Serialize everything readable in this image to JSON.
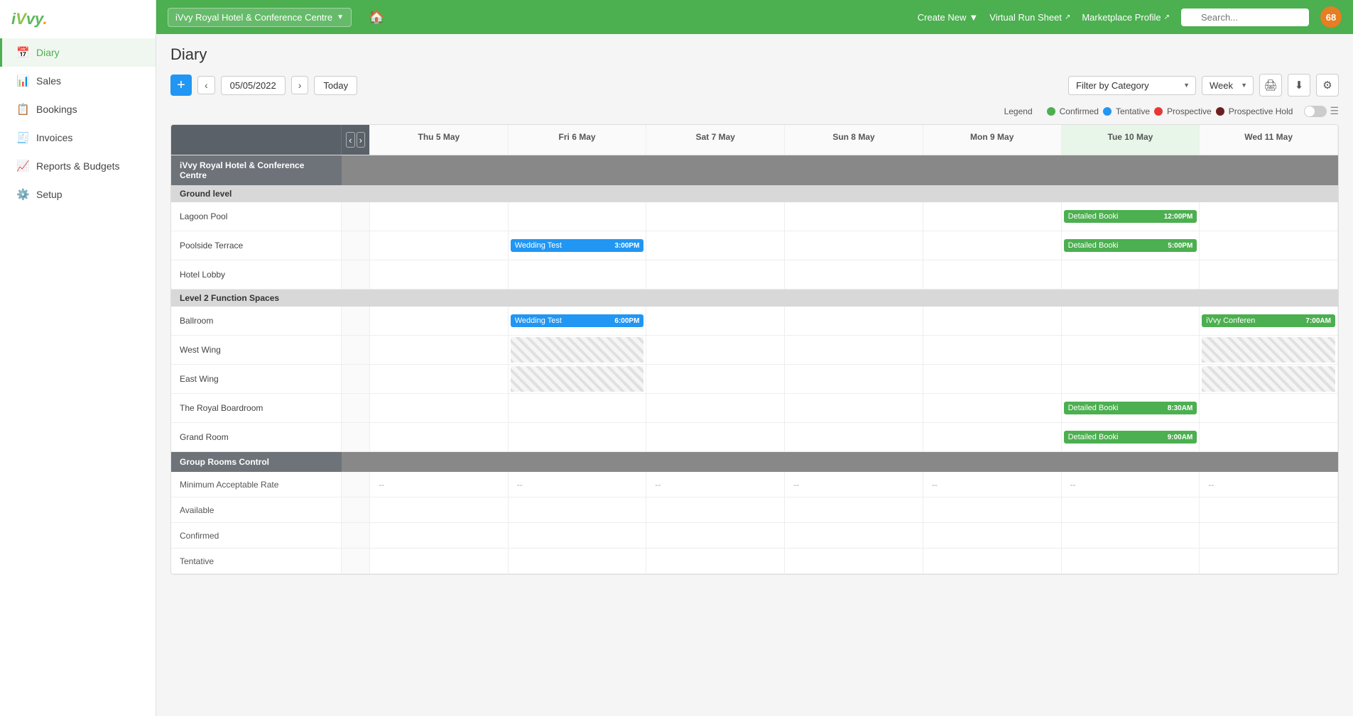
{
  "app": {
    "logo": "iVvy.",
    "badge_count": "68"
  },
  "topbar": {
    "venue": "iVvy Royal Hotel & Conference Centre",
    "home_icon": "🏠",
    "links": [
      {
        "label": "Create New",
        "ext": false,
        "dropdown": true
      },
      {
        "label": "Virtual Run Sheet",
        "ext": true
      },
      {
        "label": "Marketplace Profile",
        "ext": true
      }
    ],
    "search_placeholder": "Search..."
  },
  "sidebar": {
    "items": [
      {
        "label": "Diary",
        "icon": "📅",
        "active": true
      },
      {
        "label": "Sales",
        "icon": "📊",
        "active": false
      },
      {
        "label": "Bookings",
        "icon": "📋",
        "active": false
      },
      {
        "label": "Invoices",
        "icon": "🧾",
        "active": false
      },
      {
        "label": "Reports & Budgets",
        "icon": "📈",
        "active": false
      },
      {
        "label": "Setup",
        "icon": "⚙️",
        "active": false
      }
    ]
  },
  "diary": {
    "title": "Diary",
    "date": "05/05/2022",
    "today_label": "Today",
    "filter_placeholder": "Filter by Category",
    "view_mode": "Week",
    "legend_label": "Legend",
    "legend": [
      {
        "label": "Confirmed",
        "color": "#4caf50"
      },
      {
        "label": "Tentative",
        "color": "#2196f3"
      },
      {
        "label": "Prospective",
        "color": "#e53935"
      },
      {
        "label": "Prospective Hold",
        "color": "#8d2a2a"
      }
    ]
  },
  "calendar": {
    "days": [
      {
        "label": "Thu 5 May"
      },
      {
        "label": "Fri 6 May"
      },
      {
        "label": "Sat 7 May"
      },
      {
        "label": "Sun 8 May"
      },
      {
        "label": "Mon 9 May"
      },
      {
        "label": "Tue 10 May"
      },
      {
        "label": "Wed 11 May"
      }
    ],
    "sections": [
      {
        "label": "iVvy Royal Hotel & Conference Centre",
        "type": "venue-header"
      },
      {
        "label": "Ground level",
        "type": "subsection",
        "rooms": [
          {
            "name": "Lagoon Pool",
            "events": [
              null,
              null,
              null,
              null,
              null,
              {
                "name": "Detailed Booki",
                "time": "12:00PM",
                "type": "confirmed"
              },
              null
            ]
          },
          {
            "name": "Poolside Terrace",
            "events": [
              null,
              {
                "name": "Wedding Test",
                "time": "3:00PM",
                "type": "blue"
              },
              null,
              null,
              null,
              {
                "name": "Detailed Booki",
                "time": "5:00PM",
                "type": "confirmed"
              },
              null
            ]
          },
          {
            "name": "Hotel Lobby",
            "events": [
              null,
              null,
              null,
              null,
              null,
              null,
              null
            ]
          }
        ]
      },
      {
        "label": "Level 2 Function Spaces",
        "type": "subsection",
        "rooms": [
          {
            "name": "Ballroom",
            "events": [
              null,
              {
                "name": "Wedding Test",
                "time": "6:00PM",
                "type": "blue"
              },
              null,
              null,
              null,
              null,
              {
                "name": "iVvy Conferen",
                "time": "7:00AM",
                "type": "confirmed"
              }
            ]
          },
          {
            "name": "West Wing",
            "events": [
              null,
              "hatched",
              null,
              null,
              null,
              null,
              "hatched"
            ]
          },
          {
            "name": "East Wing",
            "events": [
              null,
              "hatched",
              null,
              null,
              null,
              null,
              "hatched"
            ]
          },
          {
            "name": "The Royal Boardroom",
            "events": [
              null,
              null,
              null,
              null,
              null,
              {
                "name": "Detailed Booki",
                "time": "8:30AM",
                "type": "confirmed"
              },
              null
            ]
          },
          {
            "name": "Grand Room",
            "events": [
              null,
              null,
              null,
              null,
              null,
              {
                "name": "Detailed Booki",
                "time": "9:00AM",
                "type": "confirmed"
              },
              null
            ]
          }
        ]
      }
    ],
    "group_rooms_control": {
      "label": "Group Rooms Control",
      "rows": [
        {
          "name": "Minimum Acceptable Rate",
          "values": [
            "--",
            "--",
            "--",
            "--",
            "--",
            "--",
            "--"
          ]
        },
        {
          "name": "Available",
          "values": [
            "",
            "",
            "",
            "",
            "",
            "",
            ""
          ]
        },
        {
          "name": "Confirmed",
          "values": [
            "",
            "",
            "",
            "",
            "",
            "",
            ""
          ]
        },
        {
          "name": "Tentative",
          "values": [
            "",
            "",
            "",
            "",
            "",
            "",
            ""
          ]
        }
      ]
    }
  }
}
